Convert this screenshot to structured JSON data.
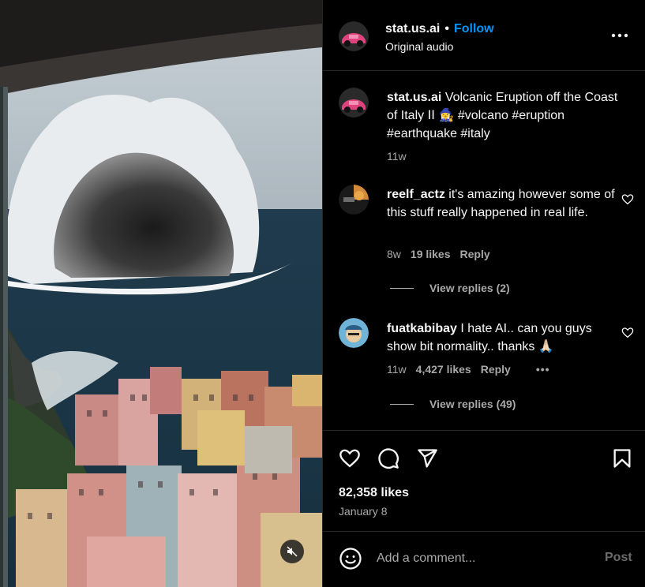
{
  "post": {
    "username": "stat.us.ai",
    "follow_label": "Follow",
    "separator": "•",
    "audio": "Original audio",
    "caption": "Volcanic Eruption off the Coast of Italy ⅠⅠ 🧙‍♀️ #volcano #eruption #earthquake #italy",
    "caption_time": "11w"
  },
  "comments": [
    {
      "username": "reelf_actz",
      "text": "it's amazing however some of this stuff really happened in real life.",
      "time": "8w",
      "likes": "19 likes",
      "reply_label": "Reply",
      "view_replies": "View replies (2)"
    },
    {
      "username": "fuatkabibay",
      "text": "I hate AI.. can you guys show bit normality.. thanks 🙏🏻",
      "time": "11w",
      "likes": "4,427 likes",
      "reply_label": "Reply",
      "more": "•••",
      "view_replies": "View replies (49)"
    }
  ],
  "actions": {
    "like_icon": "heart-icon",
    "comment_icon": "comment-icon",
    "share_icon": "share-icon",
    "save_icon": "bookmark-icon"
  },
  "likes_count": "82,358 likes",
  "post_date": "January 8",
  "composer": {
    "placeholder": "Add a comment...",
    "post_label": "Post"
  },
  "colors": {
    "background": "#000000",
    "accent": "#0095f6",
    "muted_text": "#a8a8a8",
    "divider": "#262626"
  }
}
